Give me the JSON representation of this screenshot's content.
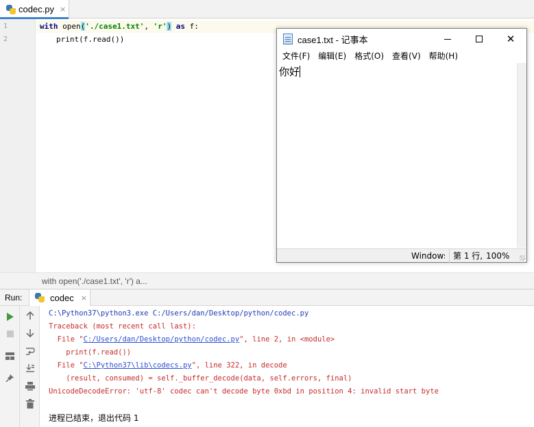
{
  "editor_tab": {
    "label": "codec.py",
    "close": "×"
  },
  "code": {
    "line_numbers": [
      "1",
      "2"
    ],
    "line1": {
      "kw_with": "with",
      "open": "open",
      "lparen": "(",
      "arg1": "'./case1.txt'",
      "comma": ", ",
      "arg2": "'r'",
      "rparen": ")",
      "kw_as": "as",
      "var": "f:"
    },
    "line2": {
      "text": "print(f.read())"
    }
  },
  "breadcrumb": "with open('./case1.txt', 'r') a...",
  "notepad": {
    "title": "case1.txt - 记事本",
    "menu": [
      "文件(F)",
      "编辑(E)",
      "格式(O)",
      "查看(V)",
      "帮助(H)"
    ],
    "content": "你好",
    "status": {
      "encoding": "Windows",
      "position": "第 1 行,",
      "zoom": "100%"
    },
    "controls": {
      "close": "✕"
    }
  },
  "run_panel": {
    "label": "Run:",
    "tab": {
      "label": "codec",
      "close": "×"
    },
    "tool_icons": {
      "col1": [
        "play-icon",
        "stop-icon",
        "layout-icon",
        "pin-icon"
      ],
      "col2": [
        "arrow-up-icon",
        "arrow-down-icon",
        "soft-wrap-icon",
        "scroll-to-end-icon",
        "print-icon",
        "trash-icon"
      ]
    },
    "console": {
      "cmd": "C:\\Python37\\python3.exe C:/Users/dan/Desktop/python/codec.py",
      "traceback": "Traceback (most recent call last):",
      "file1_prefix": "  File \"",
      "file1_path": "C:/Users/dan/Desktop/python/codec.py",
      "file1_suffix": "\", line 2, in <module>",
      "code1": "    print(f.read())",
      "file2_prefix": "  File \"",
      "file2_path": "C:\\Python37\\lib\\codecs.py",
      "file2_suffix": "\", line 322, in decode",
      "code2": "    (result, consumed) = self._buffer_decode(data, self.errors, final)",
      "error": "UnicodeDecodeError: 'utf-8' codec can't decode byte 0xbd in position 4: invalid start byte",
      "exit": "进程已结束，退出代码 1"
    }
  },
  "colors": {
    "keyword": "#000080",
    "string": "#008000",
    "error_text": "#c62a2a",
    "link": "#2c4fd1",
    "current_line": "#fcfaed",
    "tab_accent": "#4083c9"
  }
}
